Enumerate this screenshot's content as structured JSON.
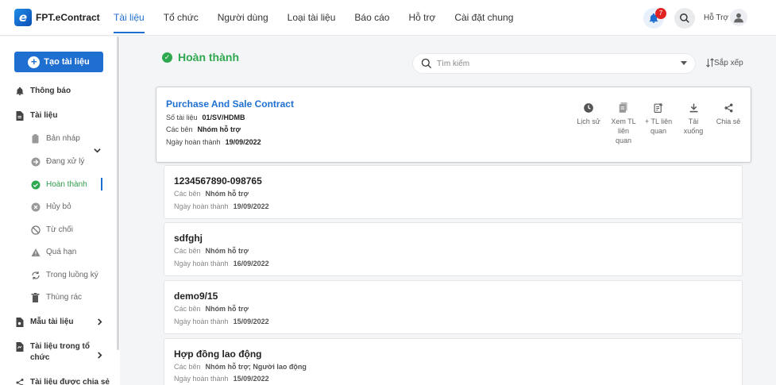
{
  "app": {
    "logo_letter": "e",
    "name": "FPT.eContract"
  },
  "nav": {
    "items": [
      "Tài liệu",
      "Tổ chức",
      "Người dùng",
      "Loại tài liệu",
      "Báo cáo",
      "Hỗ trợ",
      "Cài đặt chung"
    ],
    "active": "Tài liệu"
  },
  "header": {
    "notification_count": "7",
    "user_name": "Hỗ Trợ"
  },
  "sidebar": {
    "create_button": "Tạo tài liệu",
    "items": {
      "notifications": "Thông báo",
      "documents": "Tài liệu",
      "draft": "Bản nháp",
      "processing": "Đang xử lý",
      "completed": "Hoàn thành",
      "cancelled": "Hủy bỏ",
      "rejected": "Từ chối",
      "expired": "Quá hạn",
      "in_flow": "Trong luồng ký",
      "trash": "Thùng rác",
      "templates": "Mẫu tài liệu",
      "org_docs": "Tài liệu trong tổ chức",
      "shared_docs": "Tài liệu được chia sẻ"
    }
  },
  "main": {
    "status_title": "Hoàn thành",
    "search_placeholder": "Tìm kiếm",
    "sort_label": "Sắp xếp",
    "featured": {
      "title": "Purchase And Sale Contract",
      "doc_no_label": "Số tài liệu",
      "doc_no": "01/SV/HDMB",
      "parties_label": "Các bên",
      "parties": "Nhóm hỗ trợ",
      "date_label": "Ngày hoàn thành",
      "date": "19/09/2022",
      "actions": {
        "history": "Lịch sử",
        "view_related_1": "Xem TL",
        "view_related_2": "liên",
        "view_related_3": "quan",
        "add_related_1": "+ TL liên",
        "add_related_2": "quan",
        "download_1": "Tải",
        "download_2": "xuống",
        "share": "Chia sẻ"
      }
    },
    "documents": [
      {
        "name": "1234567890-098765",
        "parties_label": "Các bên",
        "parties": "Nhóm hỗ trợ",
        "date_label": "Ngày hoàn thành",
        "date": "19/09/2022"
      },
      {
        "name": "sdfghj",
        "parties_label": "Các bên",
        "parties": "Nhóm hỗ trợ",
        "date_label": "Ngày hoàn thành",
        "date": "16/09/2022"
      },
      {
        "name": "demo9/15",
        "parties_label": "Các bên",
        "parties": "Nhóm hỗ trợ",
        "date_label": "Ngày hoàn thành",
        "date": "15/09/2022"
      },
      {
        "name": "Hợp đồng lao động",
        "parties_label": "Các bên",
        "parties": "Nhóm hỗ trợ; Người lao động",
        "date_label": "Ngày hoàn thành",
        "date": "15/09/2022"
      }
    ]
  },
  "colors": {
    "primary": "#1f6fd1",
    "success": "#2ea84e",
    "badge": "#e02424"
  }
}
